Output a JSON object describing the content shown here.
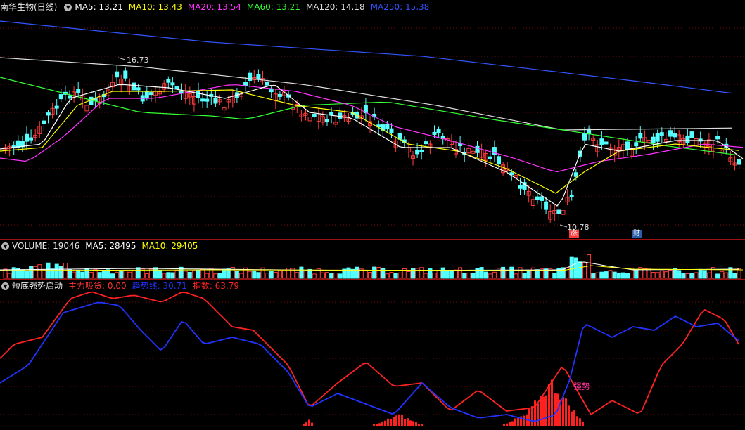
{
  "price_panel": {
    "title": "南华生物(日线)",
    "ma": [
      {
        "label": "MA5: 13.21",
        "color": "#ffffff"
      },
      {
        "label": "MA10: 13.43",
        "color": "#ffff00"
      },
      {
        "label": "MA20: 13.54",
        "color": "#ff33ff"
      },
      {
        "label": "MA60: 13.21",
        "color": "#33ff33"
      },
      {
        "label": "MA120: 14.18",
        "color": "#dddddd"
      },
      {
        "label": "MA250: 15.38",
        "color": "#3355ff"
      }
    ],
    "high_label": "16.73",
    "low_label": "10.78",
    "marker_zhang": "涨",
    "marker_cai": "财"
  },
  "volume_panel": {
    "label": "VOLUME: 19046",
    "ma5": "MA5: 28495",
    "ma10": "MA10: 29405",
    "ma5_color": "#ffffff",
    "ma10_color": "#ffff00"
  },
  "indicator_panel": {
    "title": "短底强势启动",
    "main_force": "主力吸货: 0.00",
    "trend_line": "趋势线: 30.71",
    "index": "指数: 63.79",
    "strong_label": "强势",
    "colors": {
      "main_force": "#ff3333",
      "trend_line": "#2233ff",
      "index": "#ff2222",
      "strong": "#ff3399"
    }
  },
  "colors": {
    "up": "#ff3c3c",
    "down": "#54ffff",
    "grid": "#7a0a0a"
  }
}
